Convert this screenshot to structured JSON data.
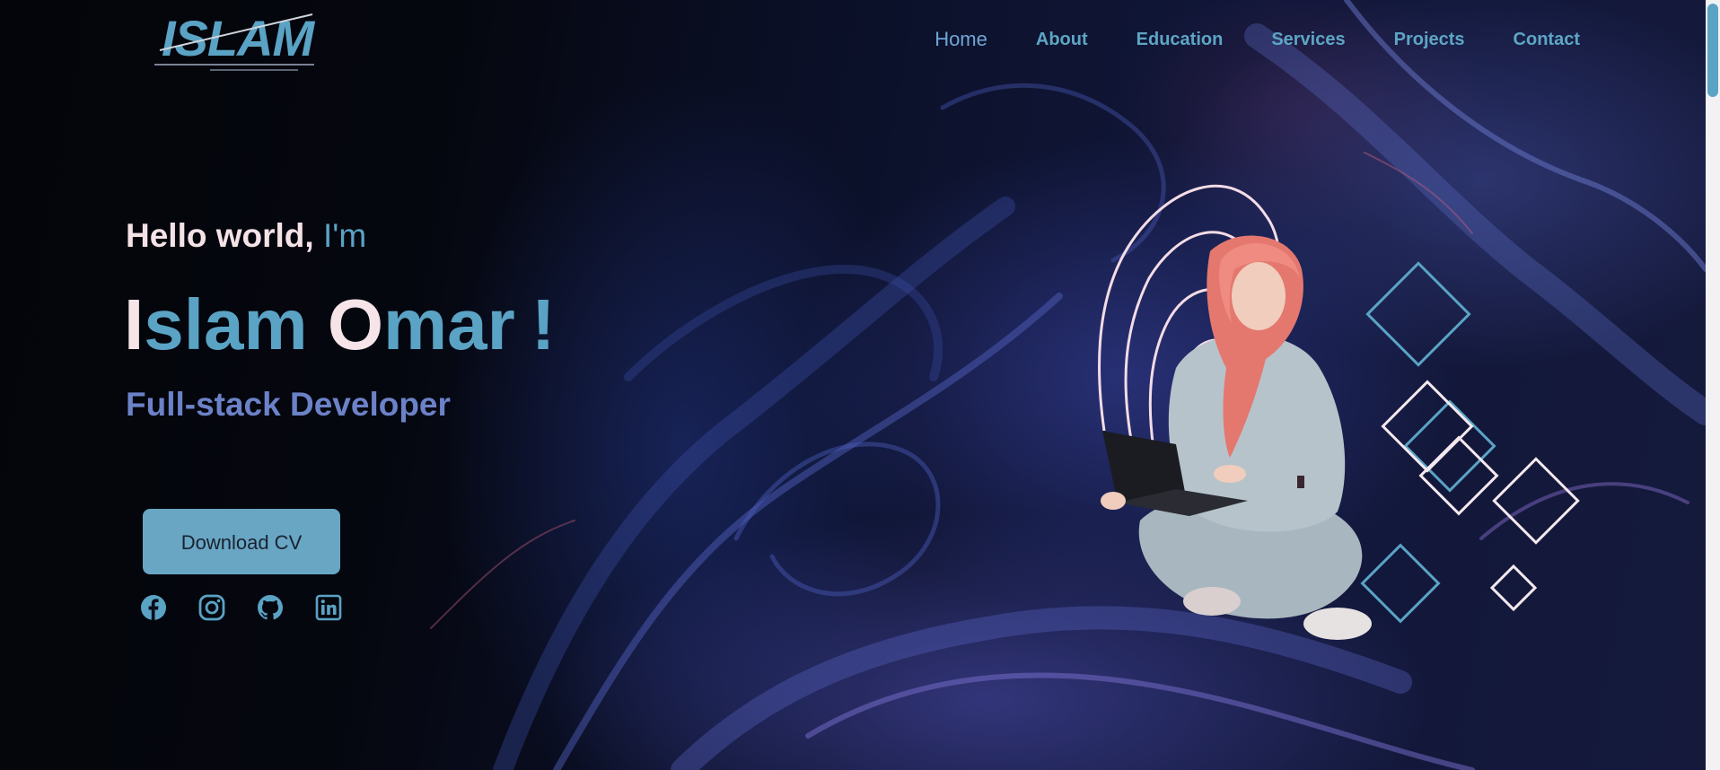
{
  "header": {
    "logo_text": "ISLAM",
    "nav": [
      {
        "label": "Home"
      },
      {
        "label": "About"
      },
      {
        "label": "Education"
      },
      {
        "label": "Services"
      },
      {
        "label": "Projects"
      },
      {
        "label": "Contact"
      }
    ]
  },
  "hero": {
    "greeting_main": "Hello world, ",
    "greeting_accent": "I'm",
    "name_first_initial": "I",
    "name_first_rest": "slam",
    "name_last_initial": "O",
    "name_last_rest": "mar",
    "name_exclaim": "!",
    "role": "Full-stack Developer",
    "cv_button": "Download CV"
  },
  "socials": [
    {
      "icon": "facebook-icon"
    },
    {
      "icon": "instagram-icon"
    },
    {
      "icon": "github-icon"
    },
    {
      "icon": "linkedin-icon"
    }
  ],
  "colors": {
    "accent": "#5aa3c5",
    "name_light": "#f6e4e8",
    "role": "#6c82c8",
    "button": "#68a6c4"
  }
}
